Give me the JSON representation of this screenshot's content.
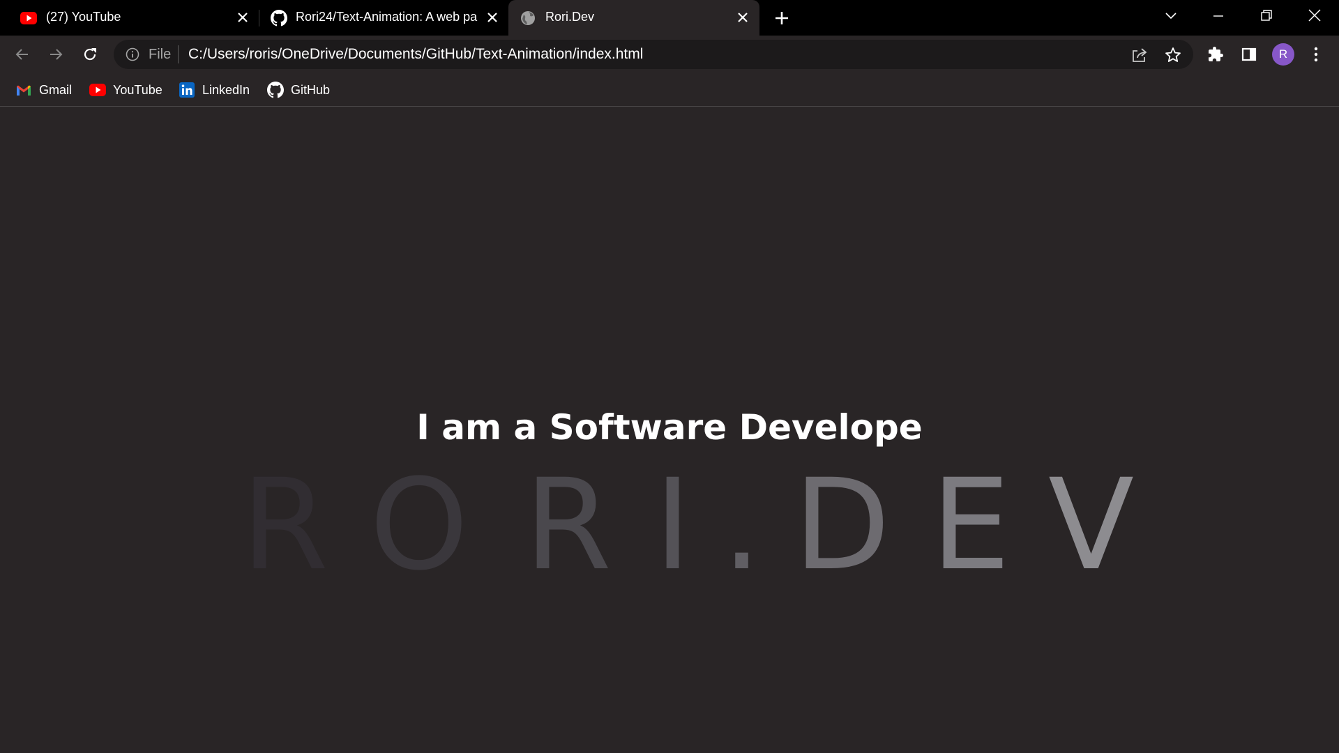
{
  "tabs": [
    {
      "title": "(27) YouTube",
      "favicon": "youtube-icon"
    },
    {
      "title": "Rori24/Text-Animation: A web pa",
      "favicon": "github-icon"
    },
    {
      "title": "Rori.Dev",
      "favicon": "globe-icon"
    }
  ],
  "toolbar": {
    "scheme_label": "File",
    "url": "C:/Users/roris/OneDrive/Documents/GitHub/Text-Animation/index.html",
    "avatar_initial": "R"
  },
  "bookmarks": [
    {
      "label": "Gmail",
      "icon": "gmail-icon"
    },
    {
      "label": "YouTube",
      "icon": "youtube-icon"
    },
    {
      "label": "LinkedIn",
      "icon": "linkedin-icon"
    },
    {
      "label": "GitHub",
      "icon": "github-icon"
    }
  ],
  "page": {
    "tagline": "I am a Software Develope",
    "brand_letters": [
      "R",
      "O",
      "R",
      "I",
      ".",
      "D",
      "E",
      "V"
    ],
    "brand_colors": [
      "#312d32",
      "#3a373c",
      "#4a484d",
      "#545257",
      "#605e63",
      "#6d6b70",
      "#7c7b80",
      "#8d8c90"
    ]
  },
  "colors": {
    "page_bg": "#292526",
    "tabstrip_bg": "#000000",
    "avatar_bg": "#8757c8",
    "youtube_red": "#ff0000",
    "linkedin_blue": "#0a66c2"
  }
}
